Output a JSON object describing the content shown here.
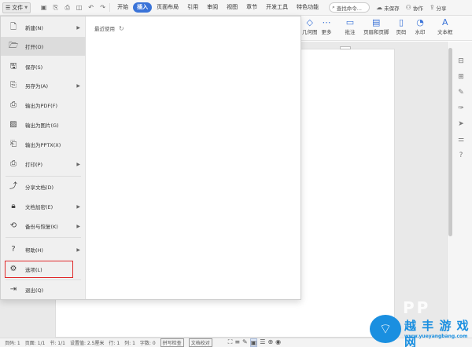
{
  "topbar": {
    "file_label": "文件",
    "tabs": [
      {
        "label": "开始",
        "active": false
      },
      {
        "label": "插入",
        "active": true
      },
      {
        "label": "页面布局",
        "active": false
      },
      {
        "label": "引用",
        "active": false
      },
      {
        "label": "审阅",
        "active": false
      },
      {
        "label": "视图",
        "active": false
      },
      {
        "label": "章节",
        "active": false
      },
      {
        "label": "开发工具",
        "active": false
      },
      {
        "label": "特色功能",
        "active": false
      }
    ],
    "search_label": "查找命令...",
    "unsaved_label": "未保存",
    "collab_label": "协作",
    "share_label": "分享",
    "accent_color": "#3a73d8"
  },
  "ribbon": {
    "geometry_label": "几何图",
    "more_label": "更多",
    "comment_label": "批注",
    "header_footer_label": "页眉和页脚",
    "page_number_label": "页码",
    "watermark_label": "水印",
    "textbox_label": "文本框"
  },
  "file_menu": {
    "items": [
      {
        "label": "新建(N)",
        "icon": "new-file-icon",
        "arrow": true
      },
      {
        "label": "打开(O)",
        "icon": "open-folder-icon",
        "arrow": false
      },
      {
        "label": "保存(S)",
        "icon": "save-icon",
        "arrow": false
      },
      {
        "label": "另存为(A)",
        "icon": "save-as-icon",
        "arrow": true
      },
      {
        "label": "输出为PDF(F)",
        "icon": "pdf-icon",
        "arrow": false
      },
      {
        "label": "输出为图片(G)",
        "icon": "image-icon",
        "arrow": false
      },
      {
        "label": "输出为PPTX(X)",
        "icon": "pptx-icon",
        "arrow": false
      },
      {
        "label": "打印(P)",
        "icon": "print-icon",
        "arrow": true
      },
      {
        "label": "分享文档(D)",
        "icon": "share-icon",
        "arrow": false
      },
      {
        "label": "文档加密(E)",
        "icon": "lock-icon",
        "arrow": true
      },
      {
        "label": "备份与恢复(K)",
        "icon": "backup-icon",
        "arrow": true
      },
      {
        "label": "帮助(H)",
        "icon": "help-icon",
        "arrow": true
      },
      {
        "label": "选项(L)",
        "icon": "gear-icon",
        "arrow": false
      },
      {
        "label": "退出(Q)",
        "icon": "exit-icon",
        "arrow": false
      }
    ],
    "recent_label": "最近使用",
    "highlight_color": "#e0292a"
  },
  "statusbar": {
    "page_num": "页码: 1",
    "page_count": "页面: 1/1",
    "section": "节: 1/1",
    "position": "设置值: 2.5厘米",
    "row": "行: 1",
    "col": "列: 1",
    "word_count": "字数: 0",
    "spellcheck": "拼写检查",
    "proofread": "文档校对"
  },
  "watermark": {
    "title": "越  丰  游  戏  网",
    "url": "www.yueyangbang.com"
  }
}
